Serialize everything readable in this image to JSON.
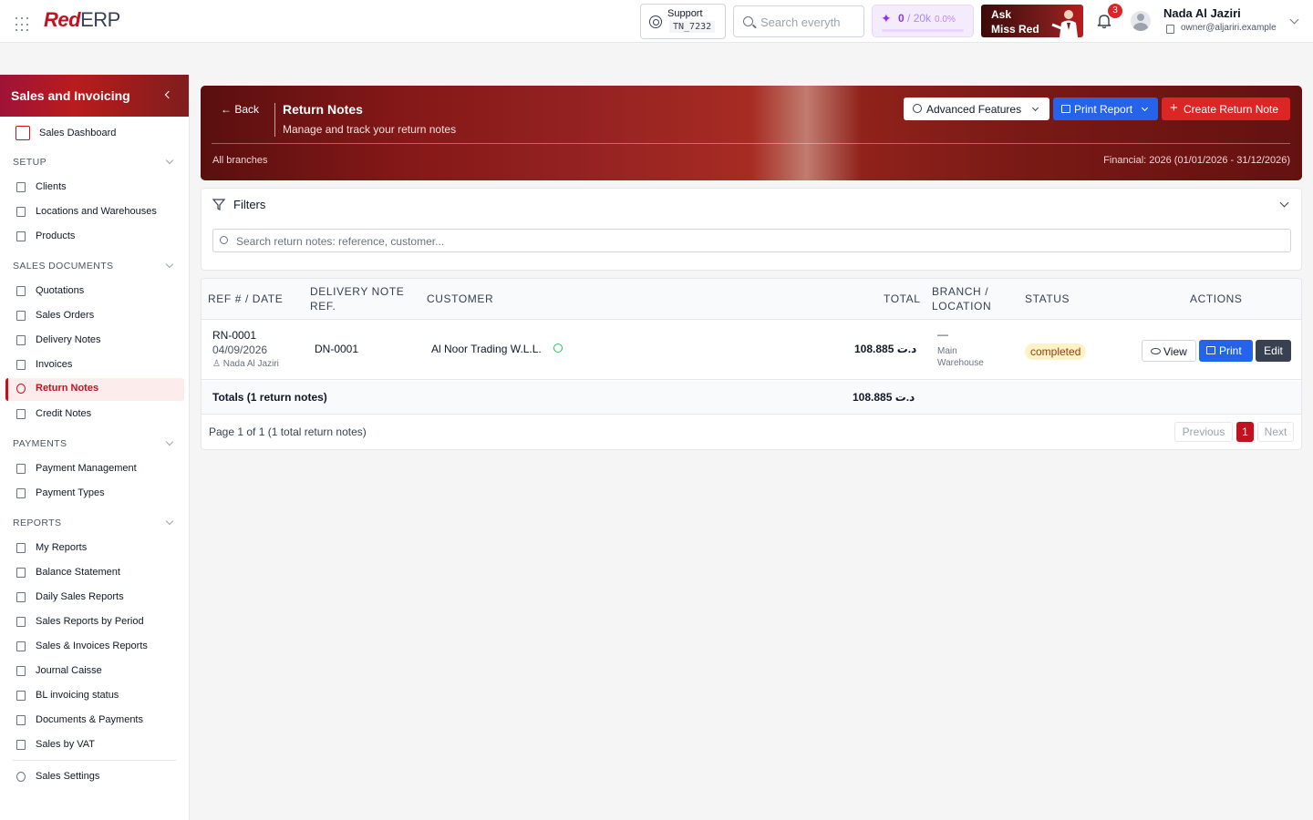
{
  "app": {
    "logo_red": "Red",
    "logo_rest": "ERP",
    "support_label": "Support",
    "support_code": "TN_7232",
    "search_placeholder": "Search everyth",
    "credits_used": "0",
    "credits_limit": "/ 20k",
    "credits_pct": "0.0%",
    "credits_fraction": 0.0,
    "ask_line1": "Ask",
    "ask_line2": "Miss Red",
    "notif_count": "3",
    "user_name": "Nada Al Jaziri",
    "user_email": "owner@aljariri.example"
  },
  "sidebar": {
    "title": "Sales and Invoicing",
    "dashboard": "Sales Dashboard",
    "setup_title": "SETUP",
    "setup": [
      "Clients",
      "Locations and Warehouses",
      "Products"
    ],
    "sales_docs_title": "SALES DOCUMENTS",
    "sales_docs": [
      "Quotations",
      "Sales Orders",
      "Delivery Notes",
      "Invoices",
      "Return Notes",
      "Credit Notes"
    ],
    "payments_title": "PAYMENTS",
    "payments": [
      "Payment Management",
      "Payment Types"
    ],
    "reports_title": "REPORTS",
    "reports": [
      "My Reports",
      "Balance Statement",
      "Daily Sales Reports",
      "Sales Reports by Period",
      "Sales & Invoices Reports",
      "Journal Caisse",
      "BL invoicing status",
      "Documents & Payments",
      "Sales by VAT"
    ],
    "settings": "Sales Settings"
  },
  "hero": {
    "back": "Back",
    "title": "Return Notes",
    "subtitle": "Manage and track your return notes",
    "branches": "All branches",
    "financial": "Financial: 2026 (01/01/2026 - 31/12/2026)",
    "advanced": "Advanced Features",
    "print_report": "Print Report",
    "create": "Create Return Note"
  },
  "filters": {
    "title": "Filters",
    "placeholder": "Search return notes: reference, customer..."
  },
  "table": {
    "headers": {
      "ref": "REF # / DATE",
      "dn_line1": "DELIVERY NOTE",
      "dn_line2": "REF.",
      "customer": "CUSTOMER",
      "total": "TOTAL",
      "branch_line1": "BRANCH /",
      "branch_line2": "LOCATION",
      "status": "STATUS",
      "actions": "ACTIONS"
    },
    "rows": [
      {
        "ref": "RN-0001",
        "date": "04/09/2026",
        "user": "Nada Al Jaziri",
        "dn_ref": "DN-0001",
        "customer": "Al Noor Trading W.L.L.",
        "total": "108.885 د.ت",
        "branch_dash": "—",
        "location_1": "Main",
        "location_2": "Warehouse",
        "status": "completed",
        "view": "View",
        "print": "Print",
        "edit": "Edit"
      }
    ],
    "totals_label": "Totals (1 return notes)",
    "totals_value": "108.885 د.ت",
    "page_info": "Page 1 of 1 (1 total return notes)",
    "prev": "Previous",
    "current": "1",
    "next": "Next"
  }
}
